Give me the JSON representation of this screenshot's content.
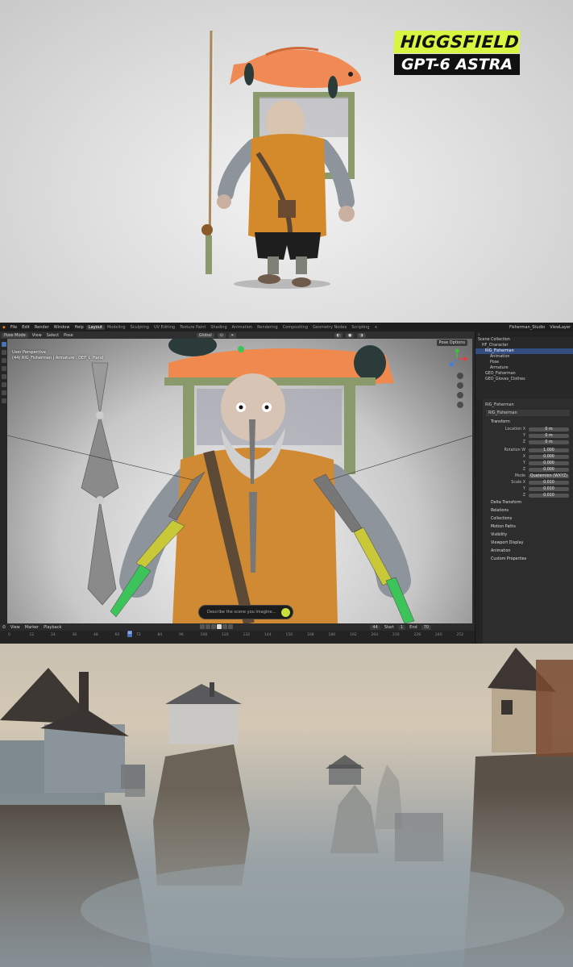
{
  "branding": {
    "line1": "HIGGSFIELD",
    "line2": "GPT-6 ASTRA"
  },
  "colors": {
    "brand_lime": "#d8f542",
    "blender_accent": "#4772b3",
    "rig_green": "#3cc45a",
    "rig_yellow": "#c8c838"
  },
  "blender": {
    "menu": [
      "File",
      "Edit",
      "Render",
      "Window",
      "Help"
    ],
    "workspaces": [
      "Layout",
      "Modeling",
      "Sculpting",
      "UV Editing",
      "Texture Paint",
      "Shading",
      "Animation",
      "Rendering",
      "Compositing",
      "Geometry Nodes",
      "Scripting"
    ],
    "active_workspace": "Layout",
    "scene_name": "Fisherman_Studio",
    "view_layer": "ViewLayer",
    "mode": "Pose Mode",
    "header_menus": [
      "View",
      "Select",
      "Pose"
    ],
    "orientation": "Global",
    "pose_options": "Pose Options",
    "viewport_line1": "User Perspective",
    "viewport_line2": "(44) RIG_Fisherman | Armature : DEF_L_Hand",
    "prompt_placeholder": "Describe the scene you imagine...",
    "timeline": {
      "menus": [
        "View",
        "Marker",
        "Playback"
      ],
      "current_frame": "44",
      "start_label": "Start",
      "start": "1",
      "end_label": "End",
      "end": "70",
      "ticks": [
        "0",
        "12",
        "24",
        "36",
        "48",
        "60",
        "72",
        "84",
        "96",
        "108",
        "120",
        "132",
        "144",
        "156",
        "168",
        "180",
        "192",
        "204",
        "216",
        "228",
        "240",
        "252"
      ]
    },
    "outliner": {
      "title": "Scene Collection",
      "rows": [
        "HF_Character",
        "RIG_Fisherman",
        "Animation",
        "Pose",
        "Armature",
        "GEO_Fisherman",
        "GEO_Gloves_Clothes"
      ]
    },
    "properties": {
      "object": "RIG_Fisherman",
      "data": "RIG_Fisherman",
      "transform_title": "Transform",
      "location": {
        "label": "Location X",
        "x": "0 m",
        "y": "0 m",
        "z": "0 m"
      },
      "rotation": {
        "label": "Rotation W",
        "w": "1.000",
        "x": "0.000",
        "y": "0.000",
        "z": "0.000"
      },
      "mode_label": "Mode",
      "mode_value": "Quaternion (WXYZ)",
      "scale": {
        "label": "Scale X",
        "x": "0.010",
        "y": "0.010",
        "z": "0.010"
      },
      "axis": {
        "y": "Y",
        "z": "Z",
        "x": "X"
      },
      "sections": [
        "Delta Transform",
        "Relations",
        "Collections",
        "Motion Paths",
        "Visibility",
        "Viewport Display",
        "Animation",
        "Custom Properties"
      ]
    }
  }
}
